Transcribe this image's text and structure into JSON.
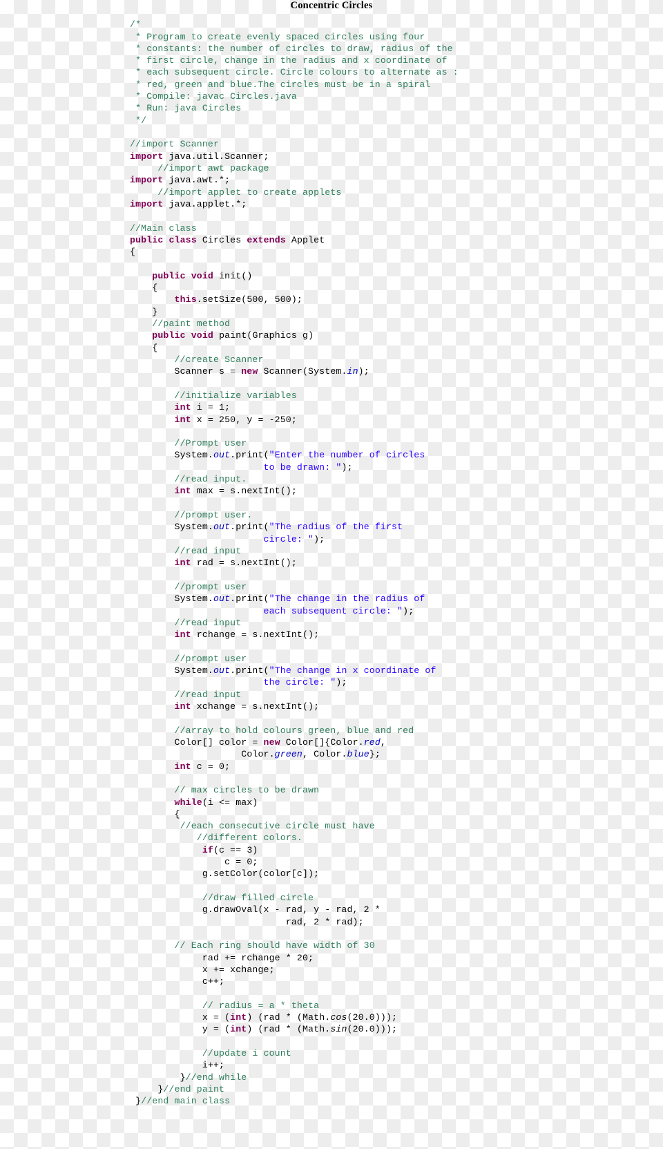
{
  "title": "Concentric Circles",
  "colors": {
    "comment": "#2e7d5b",
    "keyword": "#7f0055",
    "string": "#2a00ff",
    "field": "#0000c0",
    "plain": "#000000",
    "checker_light": "#ffffff",
    "checker_dark": "#ededed"
  },
  "code": {
    "language": "java",
    "lines": [
      [
        {
          "t": "/*",
          "c": "cm"
        }
      ],
      [
        {
          "t": " * Program to create evenly spaced circles using four",
          "c": "cm"
        }
      ],
      [
        {
          "t": " * constants: the number of circles to draw, radius of the",
          "c": "cm"
        }
      ],
      [
        {
          "t": " * first circle, change in the radius and x coordinate of",
          "c": "cm"
        }
      ],
      [
        {
          "t": " * each subsequent circle. Circle colours to alternate as :",
          "c": "cm"
        }
      ],
      [
        {
          "t": " * red, green and blue.The circles must be in a spiral",
          "c": "cm"
        }
      ],
      [
        {
          "t": " * Compile: javac Circles.java",
          "c": "cm"
        }
      ],
      [
        {
          "t": " * Run: java Circles",
          "c": "cm"
        }
      ],
      [
        {
          "t": " */",
          "c": "cm"
        }
      ],
      [],
      [
        {
          "t": "//import Scanner",
          "c": "cm"
        }
      ],
      [
        {
          "t": "import",
          "c": "kw"
        },
        {
          "t": " java.util.Scanner;",
          "c": "pl"
        }
      ],
      [
        {
          "t": "     //import awt package",
          "c": "cm"
        }
      ],
      [
        {
          "t": "import",
          "c": "kw"
        },
        {
          "t": " java.awt.*;",
          "c": "pl"
        }
      ],
      [
        {
          "t": "     //import applet to create applets",
          "c": "cm"
        }
      ],
      [
        {
          "t": "import",
          "c": "kw"
        },
        {
          "t": " java.applet.*;",
          "c": "pl"
        }
      ],
      [],
      [
        {
          "t": "//Main class",
          "c": "cm"
        }
      ],
      [
        {
          "t": "public",
          "c": "kw"
        },
        {
          "t": " ",
          "c": "pl"
        },
        {
          "t": "class",
          "c": "kw"
        },
        {
          "t": " Circles ",
          "c": "pl"
        },
        {
          "t": "extends",
          "c": "kw"
        },
        {
          "t": " Applet",
          "c": "pl"
        }
      ],
      [
        {
          "t": "{",
          "c": "pl"
        }
      ],
      [],
      [
        {
          "t": "    ",
          "c": "pl"
        },
        {
          "t": "public",
          "c": "kw"
        },
        {
          "t": " ",
          "c": "pl"
        },
        {
          "t": "void",
          "c": "kw"
        },
        {
          "t": " init()",
          "c": "pl"
        }
      ],
      [
        {
          "t": "    {",
          "c": "pl"
        }
      ],
      [
        {
          "t": "        ",
          "c": "pl"
        },
        {
          "t": "this",
          "c": "kw"
        },
        {
          "t": ".setSize(500, 500);",
          "c": "pl"
        }
      ],
      [
        {
          "t": "    }",
          "c": "pl"
        }
      ],
      [
        {
          "t": "    //paint method",
          "c": "cm"
        }
      ],
      [
        {
          "t": "    ",
          "c": "pl"
        },
        {
          "t": "public",
          "c": "kw"
        },
        {
          "t": " ",
          "c": "pl"
        },
        {
          "t": "void",
          "c": "kw"
        },
        {
          "t": " paint(Graphics g)",
          "c": "pl"
        }
      ],
      [
        {
          "t": "    {",
          "c": "pl"
        }
      ],
      [
        {
          "t": "        //create Scanner",
          "c": "cm"
        }
      ],
      [
        {
          "t": "        Scanner s = ",
          "c": "pl"
        },
        {
          "t": "new",
          "c": "kw"
        },
        {
          "t": " Scanner(System.",
          "c": "pl"
        },
        {
          "t": "in",
          "c": "fl"
        },
        {
          "t": ");",
          "c": "pl"
        }
      ],
      [],
      [
        {
          "t": "        //initialize variables",
          "c": "cm"
        }
      ],
      [
        {
          "t": "        ",
          "c": "pl"
        },
        {
          "t": "int",
          "c": "kw"
        },
        {
          "t": " i = 1;",
          "c": "pl"
        }
      ],
      [
        {
          "t": "        ",
          "c": "pl"
        },
        {
          "t": "int",
          "c": "kw"
        },
        {
          "t": " x = 250, y = -250;",
          "c": "pl"
        }
      ],
      [],
      [
        {
          "t": "        //Prompt user",
          "c": "cm"
        }
      ],
      [
        {
          "t": "        System.",
          "c": "pl"
        },
        {
          "t": "out",
          "c": "fl"
        },
        {
          "t": ".print(",
          "c": "pl"
        },
        {
          "t": "\"Enter the number of circles",
          "c": "st"
        }
      ],
      [
        {
          "t": "                        ",
          "c": "pl"
        },
        {
          "t": "to be drawn: \"",
          "c": "st"
        },
        {
          "t": ");",
          "c": "pl"
        }
      ],
      [
        {
          "t": "        //read input.",
          "c": "cm"
        }
      ],
      [
        {
          "t": "        ",
          "c": "pl"
        },
        {
          "t": "int",
          "c": "kw"
        },
        {
          "t": " max = s.nextInt();",
          "c": "pl"
        }
      ],
      [],
      [
        {
          "t": "        //prompt user.",
          "c": "cm"
        }
      ],
      [
        {
          "t": "        System.",
          "c": "pl"
        },
        {
          "t": "out",
          "c": "fl"
        },
        {
          "t": ".print(",
          "c": "pl"
        },
        {
          "t": "\"The radius of the first",
          "c": "st"
        }
      ],
      [
        {
          "t": "                        ",
          "c": "pl"
        },
        {
          "t": "circle: \"",
          "c": "st"
        },
        {
          "t": ");",
          "c": "pl"
        }
      ],
      [
        {
          "t": "        //read input",
          "c": "cm"
        }
      ],
      [
        {
          "t": "        ",
          "c": "pl"
        },
        {
          "t": "int",
          "c": "kw"
        },
        {
          "t": " rad = s.nextInt();",
          "c": "pl"
        }
      ],
      [],
      [
        {
          "t": "        //prompt user",
          "c": "cm"
        }
      ],
      [
        {
          "t": "        System.",
          "c": "pl"
        },
        {
          "t": "out",
          "c": "fl"
        },
        {
          "t": ".print(",
          "c": "pl"
        },
        {
          "t": "\"The change in the radius of",
          "c": "st"
        }
      ],
      [
        {
          "t": "                        ",
          "c": "pl"
        },
        {
          "t": "each subsequent circle: \"",
          "c": "st"
        },
        {
          "t": ");",
          "c": "pl"
        }
      ],
      [
        {
          "t": "        //read input",
          "c": "cm"
        }
      ],
      [
        {
          "t": "        ",
          "c": "pl"
        },
        {
          "t": "int",
          "c": "kw"
        },
        {
          "t": " rchange = s.nextInt();",
          "c": "pl"
        }
      ],
      [],
      [
        {
          "t": "        //prompt user",
          "c": "cm"
        }
      ],
      [
        {
          "t": "        System.",
          "c": "pl"
        },
        {
          "t": "out",
          "c": "fl"
        },
        {
          "t": ".print(",
          "c": "pl"
        },
        {
          "t": "\"The change in x coordinate of",
          "c": "st"
        }
      ],
      [
        {
          "t": "                        ",
          "c": "pl"
        },
        {
          "t": "the circle: \"",
          "c": "st"
        },
        {
          "t": ");",
          "c": "pl"
        }
      ],
      [
        {
          "t": "        //read input",
          "c": "cm"
        }
      ],
      [
        {
          "t": "        ",
          "c": "pl"
        },
        {
          "t": "int",
          "c": "kw"
        },
        {
          "t": " xchange = s.nextInt();",
          "c": "pl"
        }
      ],
      [],
      [
        {
          "t": "        //array to hold colours green, blue and red",
          "c": "cm"
        }
      ],
      [
        {
          "t": "        Color[] color = ",
          "c": "pl"
        },
        {
          "t": "new",
          "c": "kw"
        },
        {
          "t": " Color[]{Color.",
          "c": "pl"
        },
        {
          "t": "red",
          "c": "fl"
        },
        {
          "t": ",",
          "c": "pl"
        }
      ],
      [
        {
          "t": "                    Color.",
          "c": "pl"
        },
        {
          "t": "green",
          "c": "fl"
        },
        {
          "t": ", Color.",
          "c": "pl"
        },
        {
          "t": "blue",
          "c": "fl"
        },
        {
          "t": "};",
          "c": "pl"
        }
      ],
      [
        {
          "t": "        ",
          "c": "pl"
        },
        {
          "t": "int",
          "c": "kw"
        },
        {
          "t": " c = 0;",
          "c": "pl"
        }
      ],
      [],
      [
        {
          "t": "        // max circles to be drawn",
          "c": "cm"
        }
      ],
      [
        {
          "t": "        ",
          "c": "pl"
        },
        {
          "t": "while",
          "c": "kw"
        },
        {
          "t": "(i <= max)",
          "c": "pl"
        }
      ],
      [
        {
          "t": "        {",
          "c": "pl"
        }
      ],
      [
        {
          "t": "         //each consecutive circle must have",
          "c": "cm"
        }
      ],
      [
        {
          "t": "            //different colors.",
          "c": "cm"
        }
      ],
      [
        {
          "t": "             ",
          "c": "pl"
        },
        {
          "t": "if",
          "c": "kw"
        },
        {
          "t": "(c == 3)",
          "c": "pl"
        }
      ],
      [
        {
          "t": "                 c = 0;",
          "c": "pl"
        }
      ],
      [
        {
          "t": "             g.setColor(color[c]);",
          "c": "pl"
        }
      ],
      [],
      [
        {
          "t": "             //draw filled circle",
          "c": "cm"
        }
      ],
      [
        {
          "t": "             g.drawOval(x - rad, y - rad, 2 *",
          "c": "pl"
        }
      ],
      [
        {
          "t": "                            rad, 2 * rad);",
          "c": "pl"
        }
      ],
      [],
      [
        {
          "t": "        // Each ring should have width of 30",
          "c": "cm"
        }
      ],
      [
        {
          "t": "             rad += rchange * 20;",
          "c": "pl"
        }
      ],
      [
        {
          "t": "             x += xchange;",
          "c": "pl"
        }
      ],
      [
        {
          "t": "             c++;",
          "c": "pl"
        }
      ],
      [],
      [
        {
          "t": "             // radius = a * theta",
          "c": "cm"
        }
      ],
      [
        {
          "t": "             x = (",
          "c": "pl"
        },
        {
          "t": "int",
          "c": "kw"
        },
        {
          "t": ") (rad * (Math.",
          "c": "pl"
        },
        {
          "t": "cos",
          "c": "mt"
        },
        {
          "t": "(20.0)));",
          "c": "pl"
        }
      ],
      [
        {
          "t": "             y = (",
          "c": "pl"
        },
        {
          "t": "int",
          "c": "kw"
        },
        {
          "t": ") (rad * (Math.",
          "c": "pl"
        },
        {
          "t": "sin",
          "c": "mt"
        },
        {
          "t": "(20.0)));",
          "c": "pl"
        }
      ],
      [],
      [
        {
          "t": "             //update i count",
          "c": "cm"
        }
      ],
      [
        {
          "t": "             i++;",
          "c": "pl"
        }
      ],
      [
        {
          "t": "         }",
          "c": "pl"
        },
        {
          "t": "//end while",
          "c": "cm"
        }
      ],
      [
        {
          "t": "     }",
          "c": "pl"
        },
        {
          "t": "//end paint",
          "c": "cm"
        }
      ],
      [
        {
          "t": " }",
          "c": "pl"
        },
        {
          "t": "//end main class",
          "c": "cm"
        }
      ]
    ]
  }
}
